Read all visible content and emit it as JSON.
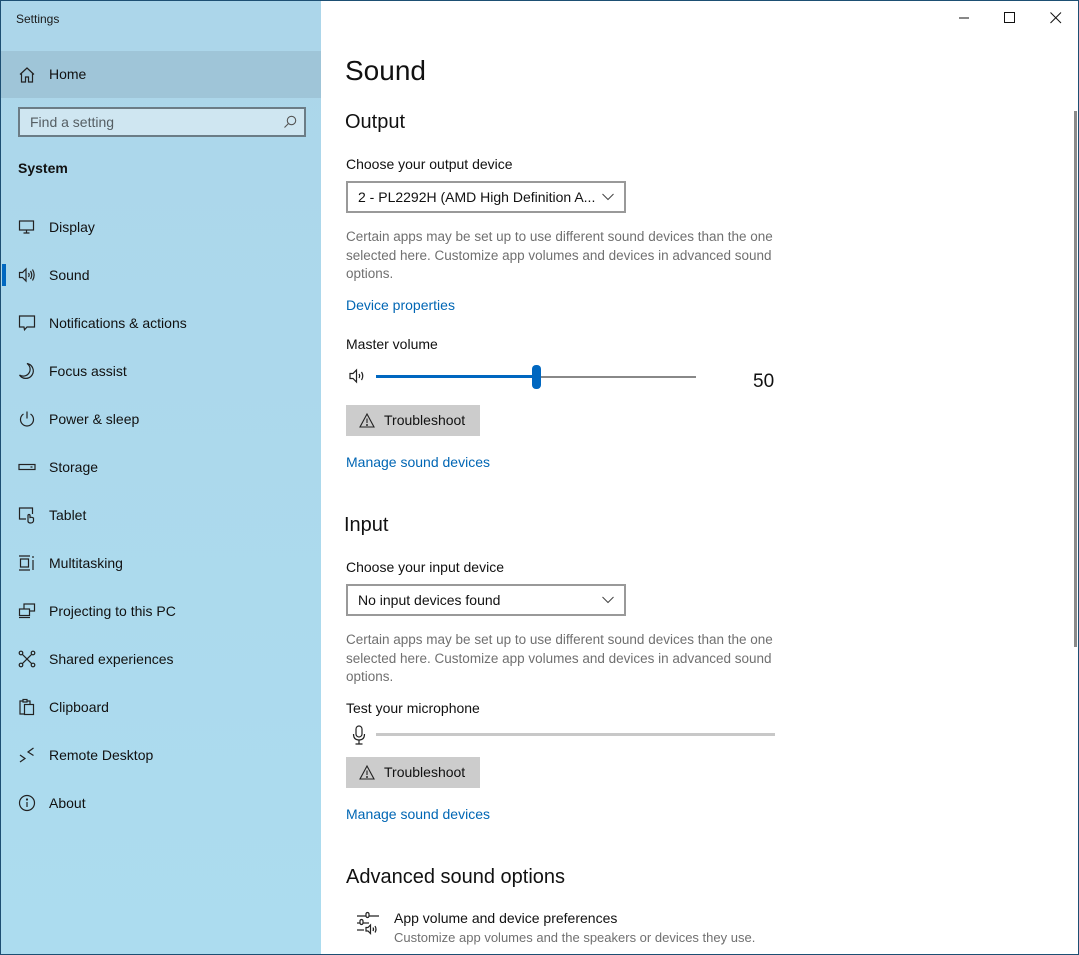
{
  "window": {
    "title": "Settings",
    "controls": {
      "minimize": "minimize",
      "maximize": "maximize",
      "close": "close"
    }
  },
  "sidebar": {
    "home": {
      "label": "Home",
      "icon": "home-icon"
    },
    "search": {
      "placeholder": "Find a setting",
      "value": "",
      "icon": "search-icon"
    },
    "group_label": "System",
    "selected": "Sound",
    "items": [
      {
        "label": "Display",
        "icon": "display-icon"
      },
      {
        "label": "Sound",
        "icon": "speaker-icon",
        "selected": true
      },
      {
        "label": "Notifications & actions",
        "icon": "notification-icon"
      },
      {
        "label": "Focus assist",
        "icon": "moon-icon"
      },
      {
        "label": "Power & sleep",
        "icon": "power-icon"
      },
      {
        "label": "Storage",
        "icon": "storage-icon"
      },
      {
        "label": "Tablet",
        "icon": "tablet-icon"
      },
      {
        "label": "Multitasking",
        "icon": "multitasking-icon"
      },
      {
        "label": "Projecting to this PC",
        "icon": "projecting-icon"
      },
      {
        "label": "Shared experiences",
        "icon": "shared-experiences-icon"
      },
      {
        "label": "Clipboard",
        "icon": "clipboard-icon"
      },
      {
        "label": "Remote Desktop",
        "icon": "remote-desktop-icon"
      },
      {
        "label": "About",
        "icon": "info-icon"
      }
    ]
  },
  "main": {
    "page_title": "Sound",
    "output": {
      "heading": "Output",
      "device_label": "Choose your output device",
      "device_selected": "2 - PL2292H (AMD High Definition A...",
      "description": "Certain apps may be set up to use different sound devices than the one selected here. Customize app volumes and devices in advanced sound options.",
      "device_properties_link": "Device properties",
      "volume_label": "Master volume",
      "volume_value": 50,
      "volume_value_text": "50",
      "volume_max": 100,
      "troubleshoot_label": "Troubleshoot",
      "manage_link": "Manage sound devices"
    },
    "input": {
      "heading": "Input",
      "device_label": "Choose your input device",
      "device_selected": "No input devices found",
      "description": "Certain apps may be set up to use different sound devices than the one selected here. Customize app volumes and devices in advanced sound options.",
      "mic_test_label": "Test your microphone",
      "mic_level": 0,
      "troubleshoot_label": "Troubleshoot",
      "manage_link": "Manage sound devices"
    },
    "advanced": {
      "heading": "Advanced sound options",
      "items": [
        {
          "title": "App volume and device preferences",
          "description": "Customize app volumes and the speakers or devices they use.",
          "icon": "app-volume-mixer-icon"
        }
      ]
    }
  },
  "colors": {
    "accent": "#0067c0",
    "link": "#0066b4",
    "sidebar_bg": "#acd9ed",
    "home_highlight": "#9fc5d8",
    "button_bg": "#cccccc",
    "description_text": "#707070"
  }
}
